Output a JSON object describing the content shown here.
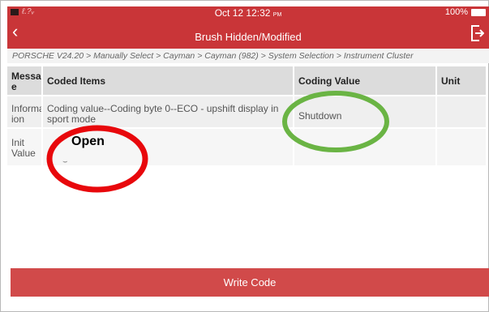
{
  "status_bar": {
    "signal": "ℓ.?ᵥ",
    "time": "Oct 12 12:32",
    "time_suffix": "PM",
    "battery_percent": "100%"
  },
  "header": {
    "title": "Brush Hidden/Modified",
    "back_icon": "back-chevron",
    "exit_icon": "exit-icon"
  },
  "breadcrumb": "PORSCHE V24.20 > Manually Select > Cayman > Cayman (982) > System Selection > Instrument Cluster",
  "table": {
    "columns": [
      "Messag e",
      "Coded Items",
      "Coding Value",
      "Unit"
    ],
    "rows": [
      {
        "message": "Informat ion",
        "coded_item": "Coding value--Coding byte 0--ECO - upshift display in sport mode",
        "coding_value": "Shutdown",
        "unit": ""
      },
      {
        "message": "Init Value",
        "coded_item": "",
        "coding_value": "",
        "unit": ""
      }
    ]
  },
  "annotations": {
    "open_label": "Open",
    "red_circle_color": "#e8080c",
    "green_circle_color": "#6ab444"
  },
  "footer": {
    "write_button": "Write Code"
  },
  "colors": {
    "accent": "#c93538",
    "button": "#d14a4a"
  }
}
